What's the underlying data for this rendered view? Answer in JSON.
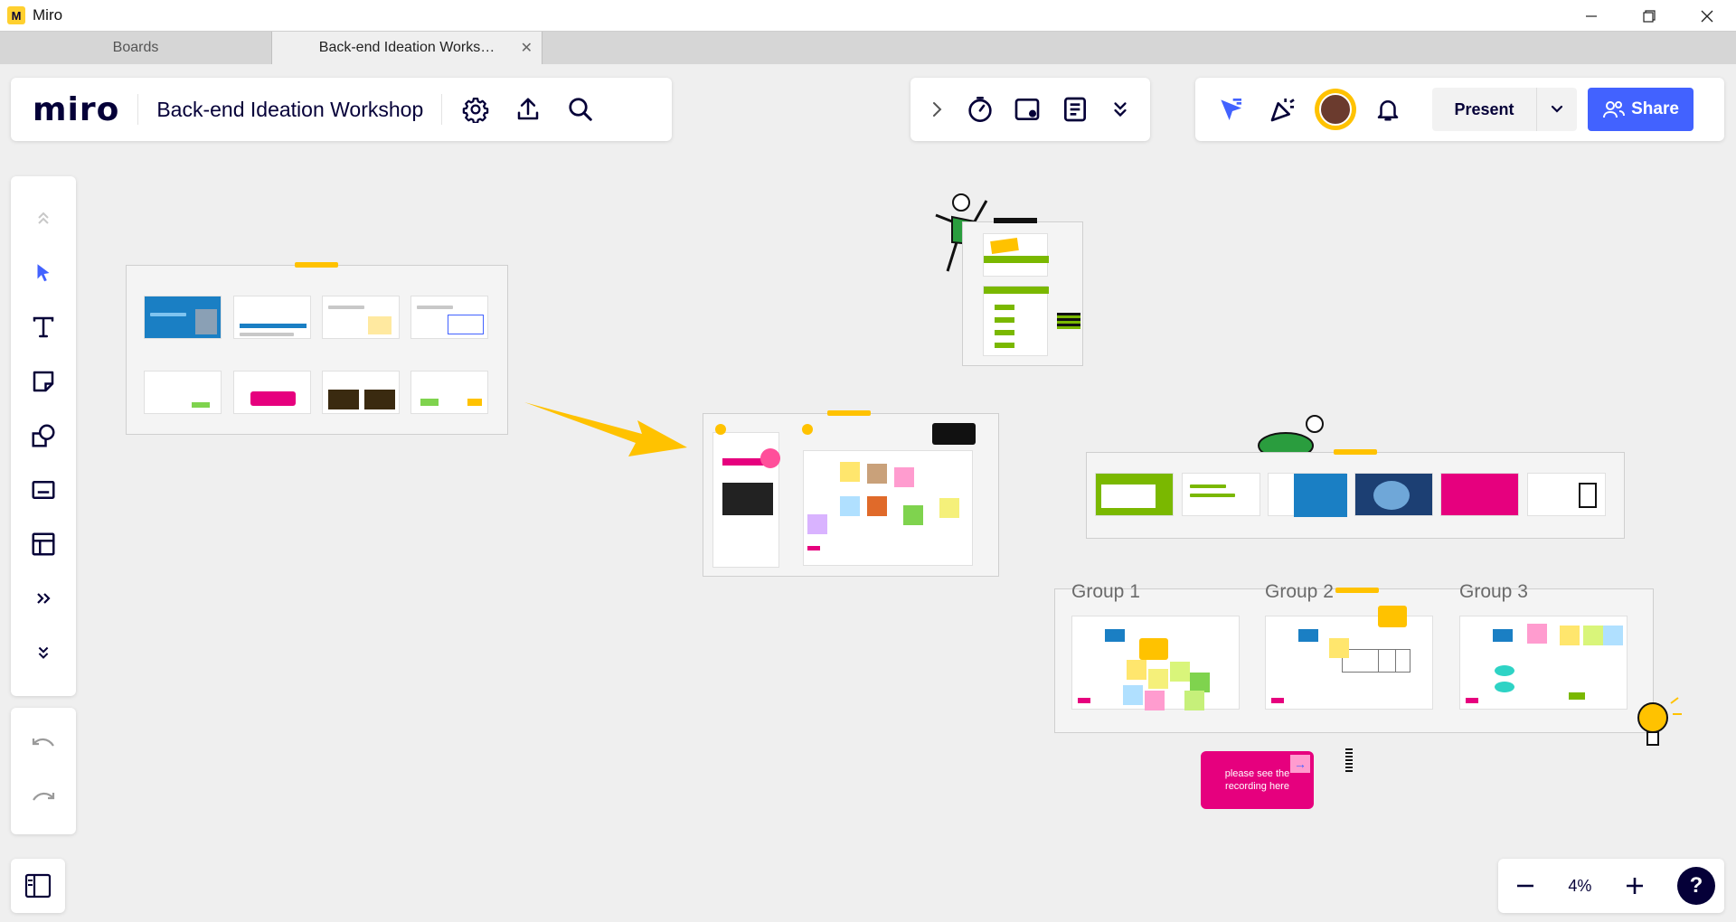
{
  "window": {
    "app_title": "Miro",
    "icon": "miro-app-icon"
  },
  "tabs": [
    {
      "label": "Boards",
      "active": false
    },
    {
      "label": "Back-end Ideation Works…",
      "active": true
    }
  ],
  "header": {
    "logo": "miro",
    "board_title": "Back-end Ideation Workshop",
    "icons": [
      "gear-icon",
      "upload-icon",
      "search-icon"
    ]
  },
  "tools_bar": {
    "icons": [
      "chevron-right-icon",
      "timer-icon",
      "card-icon",
      "notes-icon",
      "chevrons-down-icon"
    ]
  },
  "collab_bar": {
    "present_label": "Present",
    "share_label": "Share",
    "icons": [
      "cursor-icon",
      "celebrate-icon",
      "avatar",
      "bell-icon",
      "chevron-down-icon"
    ]
  },
  "left_toolbar": {
    "tools": [
      "collapse-up-icon",
      "select-icon",
      "text-icon",
      "sticky-note-icon",
      "shapes-icon",
      "card-icon",
      "template-icon",
      "more-tools-icon",
      "expand-down-icon"
    ]
  },
  "zoom": {
    "value": "4%",
    "help": "?"
  },
  "canvas": {
    "group_labels": [
      "Group 1",
      "Group 2",
      "Group 3"
    ],
    "recording_note": "please see the recording here",
    "accent_yellow": "#ffc200",
    "accent_pink": "#e6007e",
    "accent_blue": "#4262ff"
  }
}
